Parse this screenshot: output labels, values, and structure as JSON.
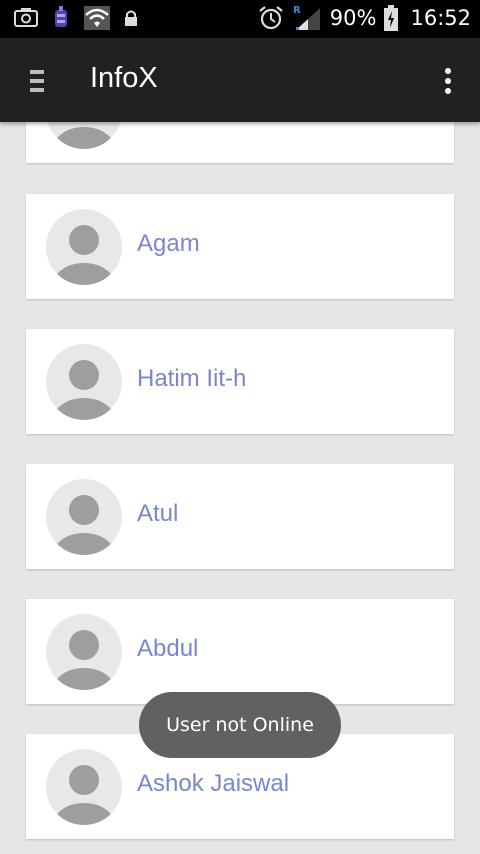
{
  "status_bar": {
    "icons": [
      "screenshot-icon",
      "app-icon",
      "wifi-icon",
      "lock-icon",
      "alarm-icon",
      "signal-icon",
      "battery-icon"
    ],
    "roaming_indicator": "R",
    "battery_percent": "90%",
    "time": "16:52"
  },
  "app_bar": {
    "title": "InfoX",
    "menu_icon": "hamburger-icon",
    "overflow_icon": "more-vert-icon"
  },
  "contacts": [
    {
      "name": ""
    },
    {
      "name": "Agam"
    },
    {
      "name": "Hatim Iit-h"
    },
    {
      "name": "Atul"
    },
    {
      "name": "Abdul"
    },
    {
      "name": "Ashok Jaiswal"
    }
  ],
  "toast": {
    "text": "User not Online"
  },
  "colors": {
    "app_bar": "#212121",
    "name_text": "#7a86cb",
    "background": "#e6e6e6",
    "toast": "#616161"
  }
}
